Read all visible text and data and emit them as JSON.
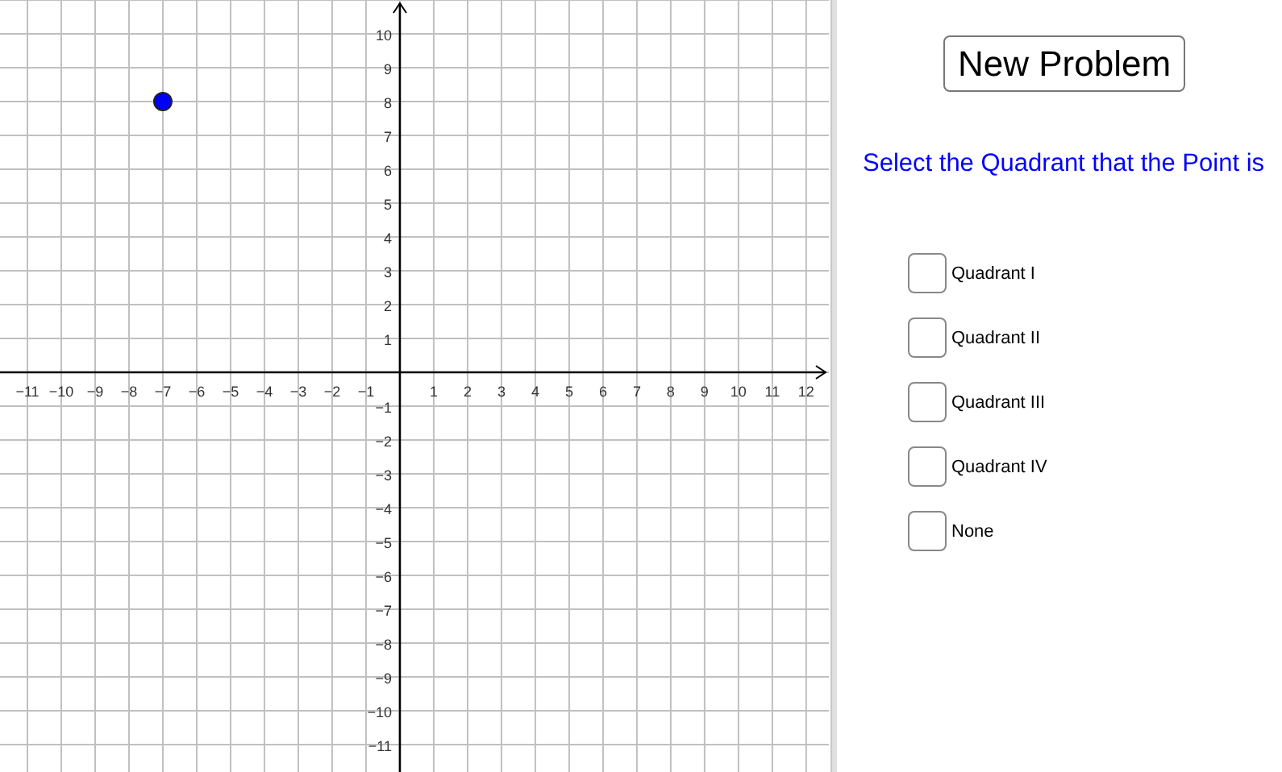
{
  "graph": {
    "chart_data": {
      "type": "scatter",
      "xlim": [
        -11.81,
        12.67
      ],
      "ylim": [
        -11.81,
        11
      ],
      "xticks": [
        {
          "value": -11,
          "label": "−11"
        },
        {
          "value": -10,
          "label": "−10"
        },
        {
          "value": -9,
          "label": "−9"
        },
        {
          "value": -8,
          "label": "−8"
        },
        {
          "value": -7,
          "label": "−7"
        },
        {
          "value": -6,
          "label": "−6"
        },
        {
          "value": -5,
          "label": "−5"
        },
        {
          "value": -4,
          "label": "−4"
        },
        {
          "value": -3,
          "label": "−3"
        },
        {
          "value": -2,
          "label": "−2"
        },
        {
          "value": -1,
          "label": "−1"
        },
        1,
        2,
        3,
        4,
        5,
        6,
        7,
        8,
        9,
        10,
        11,
        12
      ],
      "yticks": [
        {
          "value": -11,
          "label": "−11"
        },
        {
          "value": -10,
          "label": "−10"
        },
        {
          "value": -9,
          "label": "−9"
        },
        {
          "value": -8,
          "label": "−8"
        },
        {
          "value": -7,
          "label": "−7"
        },
        {
          "value": -6,
          "label": "−6"
        },
        {
          "value": -5,
          "label": "−5"
        },
        {
          "value": -4,
          "label": "−4"
        },
        {
          "value": -3,
          "label": "−3"
        },
        {
          "value": -2,
          "label": "−2"
        },
        {
          "value": -1,
          "label": "−1"
        },
        1,
        2,
        3,
        4,
        5,
        6,
        7,
        8,
        9,
        10
      ],
      "grid": true,
      "x": [
        -7
      ],
      "series": [
        {
          "color": "#0000ff",
          "values": [
            8
          ]
        }
      ]
    }
  },
  "new_problem_button": "New Problem",
  "prompt": "Select the Quadrant that the Point is",
  "options": [
    {
      "label": "Quadrant I",
      "checked": false
    },
    {
      "label": "Quadrant II",
      "checked": false
    },
    {
      "label": "Quadrant III",
      "checked": false
    },
    {
      "label": "Quadrant IV",
      "checked": false
    },
    {
      "label": "None",
      "checked": false
    }
  ]
}
